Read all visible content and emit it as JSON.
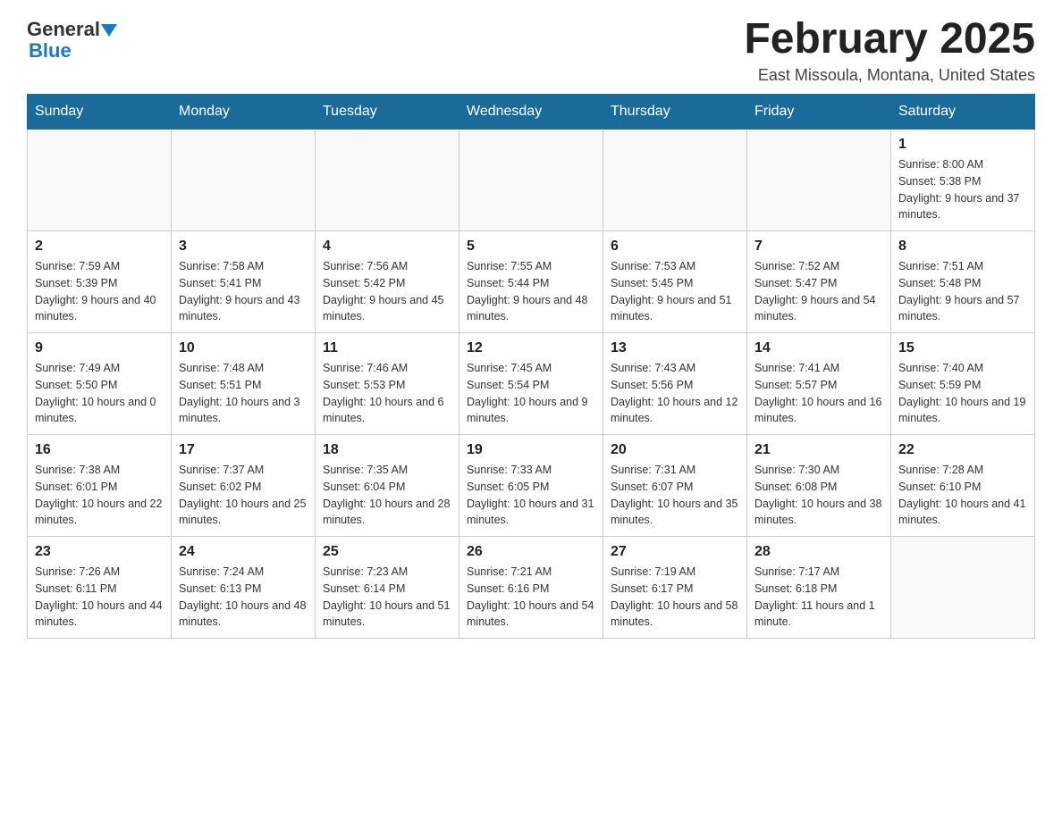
{
  "header": {
    "logo": {
      "general": "General",
      "blue": "Blue",
      "triangle": "▶"
    },
    "title": "February 2025",
    "location": "East Missoula, Montana, United States"
  },
  "calendar": {
    "days_of_week": [
      "Sunday",
      "Monday",
      "Tuesday",
      "Wednesday",
      "Thursday",
      "Friday",
      "Saturday"
    ],
    "weeks": [
      [
        {
          "day": "",
          "info": ""
        },
        {
          "day": "",
          "info": ""
        },
        {
          "day": "",
          "info": ""
        },
        {
          "day": "",
          "info": ""
        },
        {
          "day": "",
          "info": ""
        },
        {
          "day": "",
          "info": ""
        },
        {
          "day": "1",
          "info": "Sunrise: 8:00 AM\nSunset: 5:38 PM\nDaylight: 9 hours and 37 minutes."
        }
      ],
      [
        {
          "day": "2",
          "info": "Sunrise: 7:59 AM\nSunset: 5:39 PM\nDaylight: 9 hours and 40 minutes."
        },
        {
          "day": "3",
          "info": "Sunrise: 7:58 AM\nSunset: 5:41 PM\nDaylight: 9 hours and 43 minutes."
        },
        {
          "day": "4",
          "info": "Sunrise: 7:56 AM\nSunset: 5:42 PM\nDaylight: 9 hours and 45 minutes."
        },
        {
          "day": "5",
          "info": "Sunrise: 7:55 AM\nSunset: 5:44 PM\nDaylight: 9 hours and 48 minutes."
        },
        {
          "day": "6",
          "info": "Sunrise: 7:53 AM\nSunset: 5:45 PM\nDaylight: 9 hours and 51 minutes."
        },
        {
          "day": "7",
          "info": "Sunrise: 7:52 AM\nSunset: 5:47 PM\nDaylight: 9 hours and 54 minutes."
        },
        {
          "day": "8",
          "info": "Sunrise: 7:51 AM\nSunset: 5:48 PM\nDaylight: 9 hours and 57 minutes."
        }
      ],
      [
        {
          "day": "9",
          "info": "Sunrise: 7:49 AM\nSunset: 5:50 PM\nDaylight: 10 hours and 0 minutes."
        },
        {
          "day": "10",
          "info": "Sunrise: 7:48 AM\nSunset: 5:51 PM\nDaylight: 10 hours and 3 minutes."
        },
        {
          "day": "11",
          "info": "Sunrise: 7:46 AM\nSunset: 5:53 PM\nDaylight: 10 hours and 6 minutes."
        },
        {
          "day": "12",
          "info": "Sunrise: 7:45 AM\nSunset: 5:54 PM\nDaylight: 10 hours and 9 minutes."
        },
        {
          "day": "13",
          "info": "Sunrise: 7:43 AM\nSunset: 5:56 PM\nDaylight: 10 hours and 12 minutes."
        },
        {
          "day": "14",
          "info": "Sunrise: 7:41 AM\nSunset: 5:57 PM\nDaylight: 10 hours and 16 minutes."
        },
        {
          "day": "15",
          "info": "Sunrise: 7:40 AM\nSunset: 5:59 PM\nDaylight: 10 hours and 19 minutes."
        }
      ],
      [
        {
          "day": "16",
          "info": "Sunrise: 7:38 AM\nSunset: 6:01 PM\nDaylight: 10 hours and 22 minutes."
        },
        {
          "day": "17",
          "info": "Sunrise: 7:37 AM\nSunset: 6:02 PM\nDaylight: 10 hours and 25 minutes."
        },
        {
          "day": "18",
          "info": "Sunrise: 7:35 AM\nSunset: 6:04 PM\nDaylight: 10 hours and 28 minutes."
        },
        {
          "day": "19",
          "info": "Sunrise: 7:33 AM\nSunset: 6:05 PM\nDaylight: 10 hours and 31 minutes."
        },
        {
          "day": "20",
          "info": "Sunrise: 7:31 AM\nSunset: 6:07 PM\nDaylight: 10 hours and 35 minutes."
        },
        {
          "day": "21",
          "info": "Sunrise: 7:30 AM\nSunset: 6:08 PM\nDaylight: 10 hours and 38 minutes."
        },
        {
          "day": "22",
          "info": "Sunrise: 7:28 AM\nSunset: 6:10 PM\nDaylight: 10 hours and 41 minutes."
        }
      ],
      [
        {
          "day": "23",
          "info": "Sunrise: 7:26 AM\nSunset: 6:11 PM\nDaylight: 10 hours and 44 minutes."
        },
        {
          "day": "24",
          "info": "Sunrise: 7:24 AM\nSunset: 6:13 PM\nDaylight: 10 hours and 48 minutes."
        },
        {
          "day": "25",
          "info": "Sunrise: 7:23 AM\nSunset: 6:14 PM\nDaylight: 10 hours and 51 minutes."
        },
        {
          "day": "26",
          "info": "Sunrise: 7:21 AM\nSunset: 6:16 PM\nDaylight: 10 hours and 54 minutes."
        },
        {
          "day": "27",
          "info": "Sunrise: 7:19 AM\nSunset: 6:17 PM\nDaylight: 10 hours and 58 minutes."
        },
        {
          "day": "28",
          "info": "Sunrise: 7:17 AM\nSunset: 6:18 PM\nDaylight: 11 hours and 1 minute."
        },
        {
          "day": "",
          "info": ""
        }
      ]
    ]
  }
}
